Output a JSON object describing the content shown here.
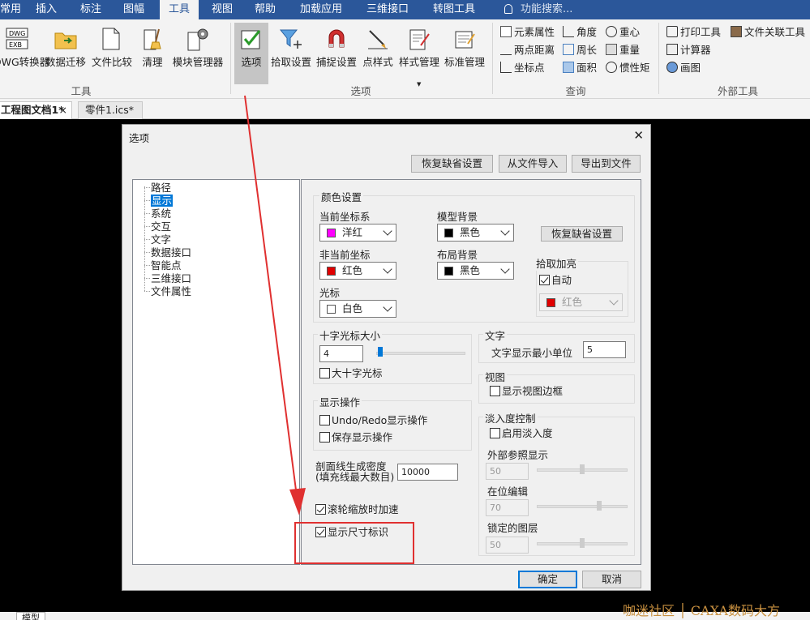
{
  "menubar": {
    "items": [
      {
        "label": "常用",
        "active": false
      },
      {
        "label": "插入",
        "active": false
      },
      {
        "label": "标注",
        "active": false
      },
      {
        "label": "图幅",
        "active": false
      },
      {
        "label": "工具",
        "active": true
      },
      {
        "label": "视图",
        "active": false
      },
      {
        "label": "帮助",
        "active": false
      },
      {
        "label": "加载应用",
        "active": false
      },
      {
        "label": "三维接口",
        "active": false
      },
      {
        "label": "转图工具",
        "active": false
      }
    ],
    "search_placeholder": "功能搜索..."
  },
  "ribbon": {
    "tools_group": {
      "label": "工具",
      "dwg_top": "DWG",
      "dwg_bottom": "EXB",
      "buttons": [
        "DWG转换器",
        "数据迁移",
        "文件比较",
        "清理",
        "模块管理器"
      ]
    },
    "options_group": {
      "label": "选项",
      "buttons": [
        "选项",
        "拾取设置",
        "捕捉设置",
        "点样式",
        "样式管理",
        "标准管理"
      ]
    },
    "query_group": {
      "label": "查询",
      "items": [
        "元素属性",
        "角度",
        "重心",
        "两点距离",
        "周长",
        "重量",
        "坐标点",
        "面积",
        "惯性矩"
      ]
    },
    "external_group": {
      "label": "外部工具",
      "items": [
        "打印工具",
        "文件关联工具",
        "计算器",
        "画图"
      ]
    }
  },
  "doc_tabs": [
    {
      "label": "工程图文档1*",
      "active": true,
      "close": "×"
    },
    {
      "label": "零件1.ics*",
      "active": false
    }
  ],
  "dialog": {
    "title": "选项",
    "close": "✕",
    "top_buttons": {
      "reset": "恢复缺省设置",
      "import": "从文件导入",
      "export": "导出到文件"
    },
    "tree": [
      "路径",
      "显示",
      "系统",
      "交互",
      "文字",
      "数据接口",
      "智能点",
      "三维接口",
      "文件属性"
    ],
    "tree_selected": "显示",
    "color_settings": {
      "title": "颜色设置",
      "current_coord_label": "当前坐标系",
      "current_coord_value": "洋红",
      "current_coord_color": "#ff00ff",
      "non_current_coord_label": "非当前坐标",
      "non_current_coord_value": "红色",
      "non_current_coord_color": "#e00000",
      "cursor_label": "光标",
      "cursor_value": "白色",
      "cursor_color": "#ffffff",
      "model_bg_label": "模型背景",
      "model_bg_value": "黑色",
      "model_bg_color": "#000000",
      "layout_bg_label": "布局背景",
      "layout_bg_value": "黑色",
      "layout_bg_color": "#000000",
      "reset_button": "恢复缺省设置",
      "pick_highlight": {
        "title": "拾取加亮",
        "auto_label": "自动",
        "auto_checked": true,
        "color_value": "红色",
        "color": "#e00000"
      }
    },
    "cross_cursor": {
      "title": "十字光标大小",
      "value": "4",
      "slider_fraction": 0.02,
      "big_cross_label": "大十字光标",
      "big_cross_checked": false
    },
    "text": {
      "title": "文字",
      "min_unit_label": "文字显示最小单位",
      "min_unit_value": "5"
    },
    "view": {
      "title": "视图",
      "show_border_label": "显示视图边框",
      "show_border_checked": false
    },
    "display_ops": {
      "title": "显示操作",
      "undo_redo_label": "Undo/Redo显示操作",
      "undo_redo_checked": false,
      "save_label": "保存显示操作",
      "save_checked": false
    },
    "fade": {
      "title": "淡入度控制",
      "enable_label": "启用淡入度",
      "enable_checked": false,
      "external_ref_label": "外部参照显示",
      "external_ref_value": "50",
      "external_ref_fraction": 0.5,
      "inplace_label": "在位编辑",
      "inplace_value": "70",
      "inplace_fraction": 0.7,
      "locked_layer_label": "锁定的图层",
      "locked_layer_value": "50",
      "locked_layer_fraction": 0.5
    },
    "hatch": {
      "label_line1": "剖面线生成密度",
      "label_line2": "(填充线最大数目)",
      "value": "10000"
    },
    "wheel_accel": {
      "label": "滚轮缩放时加速",
      "checked": true
    },
    "show_dimension": {
      "label": "显示尺寸标识",
      "checked": true
    },
    "ok": "确定",
    "cancel": "取消"
  },
  "bottom_tab": "模型",
  "watermark": "咖迷社区 │ CAXA数码大方",
  "colors": {
    "menubar_bg": "#2b579a",
    "annotation_red": "#e03030"
  }
}
